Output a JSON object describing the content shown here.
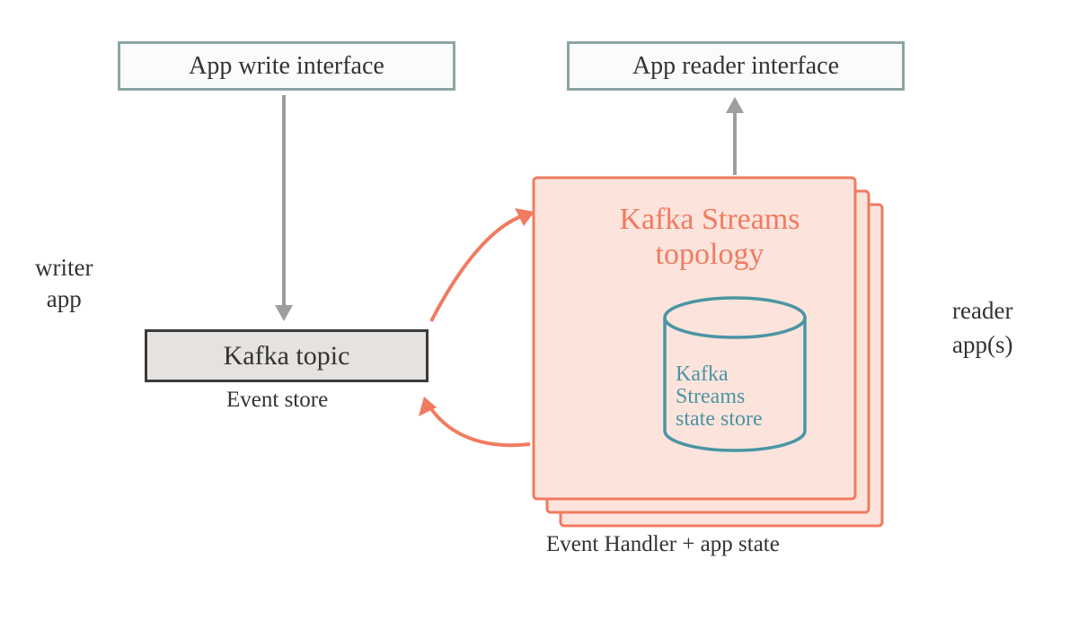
{
  "boxes": {
    "write_interface": "App write interface",
    "reader_interface": "App reader interface",
    "kafka_topic": "Kafka topic"
  },
  "labels": {
    "event_store": "Event store",
    "writer_app": "writer\napp",
    "reader_apps": "reader\napp(s)",
    "event_handler": "Event Handler + app state"
  },
  "streams": {
    "title": "Kafka Streams\ntopology",
    "state_store": "Kafka\nStreams\nstate store"
  },
  "colors": {
    "box_border": "#8aa6a4",
    "topic_fill": "#e5e2e0",
    "streams_stroke": "#f07b60",
    "streams_fill": "#fce4dd",
    "store_stroke": "#4b95a3",
    "arrow_grey": "#9e9e9e"
  }
}
